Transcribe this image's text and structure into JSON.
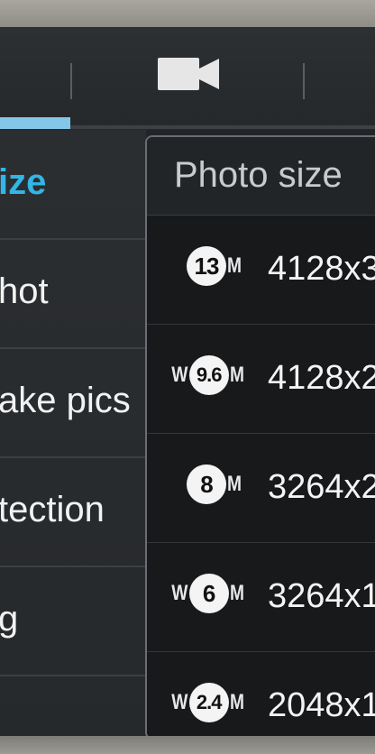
{
  "tabs": [
    {
      "label": "",
      "icon": "camera-icon",
      "active": true
    },
    {
      "label": "",
      "icon": "video-camera-icon",
      "active": false
    }
  ],
  "settings_list": [
    {
      "label": "ize",
      "selected": true
    },
    {
      "label": "hot"
    },
    {
      "label": "ake pics"
    },
    {
      "label": "tection"
    },
    {
      "label": "g"
    }
  ],
  "popup": {
    "title": "Photo size",
    "options": [
      {
        "wide": "",
        "megapixels": "13",
        "unit": "M",
        "resolution": "4128x3"
      },
      {
        "wide": "W",
        "megapixels": "9.6",
        "unit": "M",
        "resolution": "4128x2"
      },
      {
        "wide": "",
        "megapixels": "8",
        "unit": "M",
        "resolution": "3264x2"
      },
      {
        "wide": "W",
        "megapixels": "6",
        "unit": "M",
        "resolution": "3264x1"
      },
      {
        "wide": "W",
        "megapixels": "2.4",
        "unit": "M",
        "resolution": "2048x1"
      }
    ]
  },
  "colors": {
    "accent": "#33b5e5",
    "tab_indicator": "#84c6e8",
    "panel_bg": "#222528",
    "popup_bg": "#17191b"
  }
}
